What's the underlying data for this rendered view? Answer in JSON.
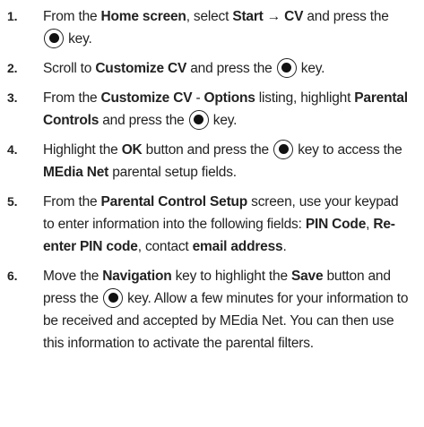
{
  "steps": [
    {
      "number": "1.",
      "segments": [
        {
          "text": "From the ",
          "bold": false
        },
        {
          "text": "Home screen",
          "bold": true
        },
        {
          "text": ", select ",
          "bold": false
        },
        {
          "text": "Start → CV",
          "bold": true
        },
        {
          "text": " and press the ",
          "bold": false
        },
        {
          "icon": "select-key-icon"
        },
        {
          "text": " key.",
          "bold": false
        }
      ]
    },
    {
      "number": "2.",
      "segments": [
        {
          "text": "Scroll to ",
          "bold": false
        },
        {
          "text": "Customize CV",
          "bold": true
        },
        {
          "text": " and press the ",
          "bold": false
        },
        {
          "icon": "select-key-icon"
        },
        {
          "text": " key.",
          "bold": false
        }
      ]
    },
    {
      "number": "3.",
      "segments": [
        {
          "text": "From the ",
          "bold": false
        },
        {
          "text": "Customize CV",
          "bold": true
        },
        {
          "text": " - ",
          "bold": false
        },
        {
          "text": "Options",
          "bold": true
        },
        {
          "text": " listing, highlight ",
          "bold": false
        },
        {
          "text": "Parental Controls",
          "bold": true
        },
        {
          "text": " and press the ",
          "bold": false
        },
        {
          "icon": "select-key-icon"
        },
        {
          "text": " key.",
          "bold": false
        }
      ]
    },
    {
      "number": "4.",
      "segments": [
        {
          "text": "Highlight the ",
          "bold": false
        },
        {
          "text": "OK",
          "bold": true
        },
        {
          "text": " button and press the ",
          "bold": false
        },
        {
          "icon": "select-key-icon"
        },
        {
          "text": " key to access the ",
          "bold": false
        },
        {
          "text": "MEdia Net",
          "bold": true
        },
        {
          "text": " parental setup fields.",
          "bold": false
        }
      ]
    },
    {
      "number": "5.",
      "segments": [
        {
          "text": "From the ",
          "bold": false
        },
        {
          "text": "Parental Control Setup",
          "bold": true
        },
        {
          "text": " screen, use your keypad to enter information into the following fields: ",
          "bold": false
        },
        {
          "text": "PIN Code",
          "bold": true
        },
        {
          "text": ", ",
          "bold": false
        },
        {
          "text": "Re-enter PIN code",
          "bold": true
        },
        {
          "text": ", contact ",
          "bold": false
        },
        {
          "text": "email address",
          "bold": true
        },
        {
          "text": ".",
          "bold": false
        }
      ]
    },
    {
      "number": "6.",
      "segments": [
        {
          "text": "Move the ",
          "bold": false
        },
        {
          "text": "Navigation",
          "bold": true
        },
        {
          "text": " key to highlight the ",
          "bold": false
        },
        {
          "text": "Save",
          "bold": true
        },
        {
          "text": " button and press the ",
          "bold": false
        },
        {
          "icon": "select-key-icon"
        },
        {
          "text": " key. Allow a few minutes for your information to be received and accepted by MEdia Net. You can then use this information to activate the parental filters.",
          "bold": false
        }
      ]
    }
  ]
}
